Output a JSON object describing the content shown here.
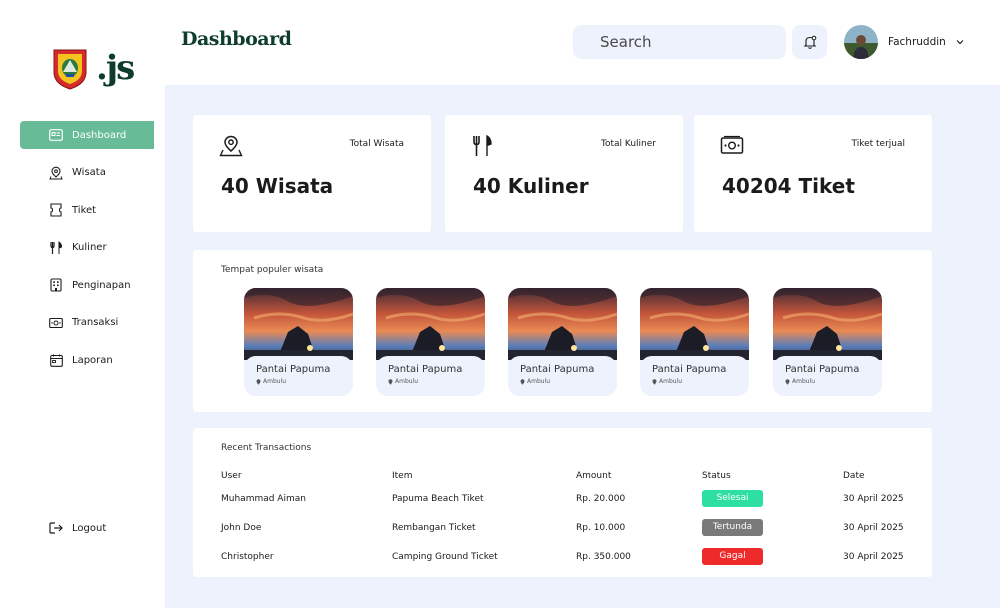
{
  "header": {
    "title": "Dashboard",
    "search_placeholder": "Search",
    "user_name": "Fachruddin"
  },
  "brand": {
    "mark": ".js"
  },
  "sidebar": {
    "items": [
      {
        "label": "Dashboard",
        "icon": "dashboard-icon",
        "active": true
      },
      {
        "label": "Wisata",
        "icon": "map-pin-icon"
      },
      {
        "label": "Tiket",
        "icon": "ticket-icon"
      },
      {
        "label": "Kuliner",
        "icon": "fork-knife-icon"
      },
      {
        "label": "Penginapan",
        "icon": "building-icon"
      },
      {
        "label": "Transaksi",
        "icon": "money-icon"
      },
      {
        "label": "Laporan",
        "icon": "calendar-report-icon"
      }
    ],
    "logout_label": "Logout"
  },
  "stats": [
    {
      "label": "Total Wisata",
      "value": "40 Wisata",
      "icon": "map-pin-icon"
    },
    {
      "label": "Total Kuliner",
      "value": "40 Kuliner",
      "icon": "fork-knife-icon"
    },
    {
      "label": "Tiket terjual",
      "value": "40204 Tiket",
      "icon": "money-icon"
    }
  ],
  "popular": {
    "title": "Tempat populer wisata",
    "places": [
      {
        "name": "Pantai Papuma",
        "location": "Ambulu"
      },
      {
        "name": "Pantai Papuma",
        "location": "Ambulu"
      },
      {
        "name": "Pantai Papuma",
        "location": "Ambulu"
      },
      {
        "name": "Pantai Papuma",
        "location": "Ambulu"
      },
      {
        "name": "Pantai Papuma",
        "location": "Ambulu"
      }
    ]
  },
  "transactions": {
    "title": "Recent Transactions",
    "columns": [
      "User",
      "Item",
      "Amount",
      "Status",
      "Date"
    ],
    "rows": [
      {
        "user": "Muhammad Aiman",
        "item": "Papuma Beach Tiket",
        "amount": "Rp. 20.000",
        "status": "Selesai",
        "date": "30 April 2025"
      },
      {
        "user": "John Doe",
        "item": "Rembangan Ticket",
        "amount": "Rp. 10.000",
        "status": "Tertunda",
        "date": "30 April 2025"
      },
      {
        "user": "Christopher",
        "item": "Camping Ground Ticket",
        "amount": "Rp. 350.000",
        "status": "Gagal",
        "date": "30 April 2025"
      }
    ]
  },
  "colors": {
    "accent": "#67bc97",
    "brand_dark": "#0f3d2b",
    "background": "#edf2fd",
    "status_selesai": "#2de0a2",
    "status_tertunda": "#7a7a7a",
    "status_gagal": "#ef2a2a"
  }
}
